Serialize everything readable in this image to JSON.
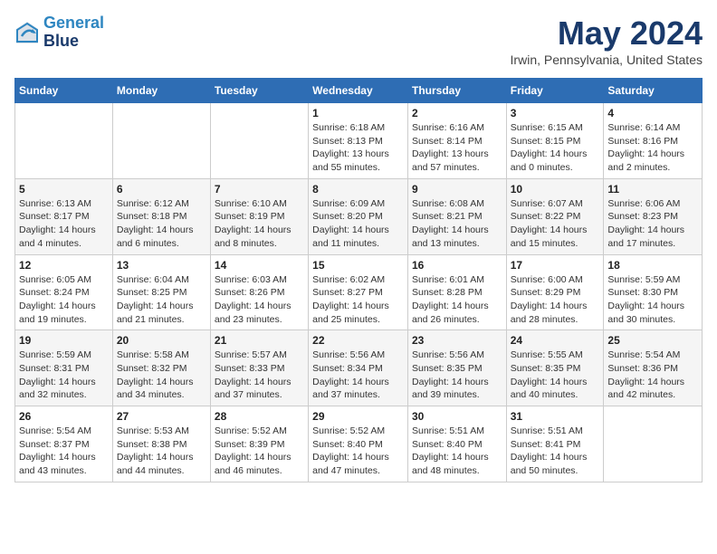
{
  "header": {
    "logo_line1": "General",
    "logo_line2": "Blue",
    "month_title": "May 2024",
    "location": "Irwin, Pennsylvania, United States"
  },
  "days_of_week": [
    "Sunday",
    "Monday",
    "Tuesday",
    "Wednesday",
    "Thursday",
    "Friday",
    "Saturday"
  ],
  "weeks": [
    [
      {
        "day": "",
        "info": ""
      },
      {
        "day": "",
        "info": ""
      },
      {
        "day": "",
        "info": ""
      },
      {
        "day": "1",
        "info": "Sunrise: 6:18 AM\nSunset: 8:13 PM\nDaylight: 13 hours\nand 55 minutes."
      },
      {
        "day": "2",
        "info": "Sunrise: 6:16 AM\nSunset: 8:14 PM\nDaylight: 13 hours\nand 57 minutes."
      },
      {
        "day": "3",
        "info": "Sunrise: 6:15 AM\nSunset: 8:15 PM\nDaylight: 14 hours\nand 0 minutes."
      },
      {
        "day": "4",
        "info": "Sunrise: 6:14 AM\nSunset: 8:16 PM\nDaylight: 14 hours\nand 2 minutes."
      }
    ],
    [
      {
        "day": "5",
        "info": "Sunrise: 6:13 AM\nSunset: 8:17 PM\nDaylight: 14 hours\nand 4 minutes."
      },
      {
        "day": "6",
        "info": "Sunrise: 6:12 AM\nSunset: 8:18 PM\nDaylight: 14 hours\nand 6 minutes."
      },
      {
        "day": "7",
        "info": "Sunrise: 6:10 AM\nSunset: 8:19 PM\nDaylight: 14 hours\nand 8 minutes."
      },
      {
        "day": "8",
        "info": "Sunrise: 6:09 AM\nSunset: 8:20 PM\nDaylight: 14 hours\nand 11 minutes."
      },
      {
        "day": "9",
        "info": "Sunrise: 6:08 AM\nSunset: 8:21 PM\nDaylight: 14 hours\nand 13 minutes."
      },
      {
        "day": "10",
        "info": "Sunrise: 6:07 AM\nSunset: 8:22 PM\nDaylight: 14 hours\nand 15 minutes."
      },
      {
        "day": "11",
        "info": "Sunrise: 6:06 AM\nSunset: 8:23 PM\nDaylight: 14 hours\nand 17 minutes."
      }
    ],
    [
      {
        "day": "12",
        "info": "Sunrise: 6:05 AM\nSunset: 8:24 PM\nDaylight: 14 hours\nand 19 minutes."
      },
      {
        "day": "13",
        "info": "Sunrise: 6:04 AM\nSunset: 8:25 PM\nDaylight: 14 hours\nand 21 minutes."
      },
      {
        "day": "14",
        "info": "Sunrise: 6:03 AM\nSunset: 8:26 PM\nDaylight: 14 hours\nand 23 minutes."
      },
      {
        "day": "15",
        "info": "Sunrise: 6:02 AM\nSunset: 8:27 PM\nDaylight: 14 hours\nand 25 minutes."
      },
      {
        "day": "16",
        "info": "Sunrise: 6:01 AM\nSunset: 8:28 PM\nDaylight: 14 hours\nand 26 minutes."
      },
      {
        "day": "17",
        "info": "Sunrise: 6:00 AM\nSunset: 8:29 PM\nDaylight: 14 hours\nand 28 minutes."
      },
      {
        "day": "18",
        "info": "Sunrise: 5:59 AM\nSunset: 8:30 PM\nDaylight: 14 hours\nand 30 minutes."
      }
    ],
    [
      {
        "day": "19",
        "info": "Sunrise: 5:59 AM\nSunset: 8:31 PM\nDaylight: 14 hours\nand 32 minutes."
      },
      {
        "day": "20",
        "info": "Sunrise: 5:58 AM\nSunset: 8:32 PM\nDaylight: 14 hours\nand 34 minutes."
      },
      {
        "day": "21",
        "info": "Sunrise: 5:57 AM\nSunset: 8:33 PM\nDaylight: 14 hours\nand 37 minutes."
      },
      {
        "day": "22",
        "info": "Sunrise: 5:56 AM\nSunset: 8:34 PM\nDaylight: 14 hours\nand 37 minutes."
      },
      {
        "day": "23",
        "info": "Sunrise: 5:56 AM\nSunset: 8:35 PM\nDaylight: 14 hours\nand 39 minutes."
      },
      {
        "day": "24",
        "info": "Sunrise: 5:55 AM\nSunset: 8:35 PM\nDaylight: 14 hours\nand 40 minutes."
      },
      {
        "day": "25",
        "info": "Sunrise: 5:54 AM\nSunset: 8:36 PM\nDaylight: 14 hours\nand 42 minutes."
      }
    ],
    [
      {
        "day": "26",
        "info": "Sunrise: 5:54 AM\nSunset: 8:37 PM\nDaylight: 14 hours\nand 43 minutes."
      },
      {
        "day": "27",
        "info": "Sunrise: 5:53 AM\nSunset: 8:38 PM\nDaylight: 14 hours\nand 44 minutes."
      },
      {
        "day": "28",
        "info": "Sunrise: 5:52 AM\nSunset: 8:39 PM\nDaylight: 14 hours\nand 46 minutes."
      },
      {
        "day": "29",
        "info": "Sunrise: 5:52 AM\nSunset: 8:40 PM\nDaylight: 14 hours\nand 47 minutes."
      },
      {
        "day": "30",
        "info": "Sunrise: 5:51 AM\nSunset: 8:40 PM\nDaylight: 14 hours\nand 48 minutes."
      },
      {
        "day": "31",
        "info": "Sunrise: 5:51 AM\nSunset: 8:41 PM\nDaylight: 14 hours\nand 50 minutes."
      },
      {
        "day": "",
        "info": ""
      }
    ]
  ]
}
